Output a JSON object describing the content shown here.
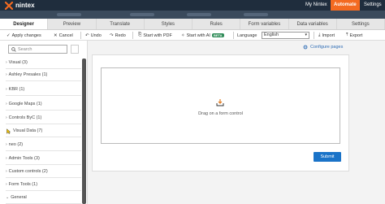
{
  "topbar": {
    "brand": "nintex",
    "links": [
      "My Nintex",
      "Automate",
      "Settings"
    ],
    "active_link": "Automate"
  },
  "tabs": [
    "Designer",
    "Preview",
    "Translate",
    "Styles",
    "Rules",
    "Form variables",
    "Data variables",
    "Settings"
  ],
  "active_tab": "Designer",
  "toolbar": {
    "apply": "Apply changes",
    "cancel": "Cancel",
    "undo": "Undo",
    "redo": "Redo",
    "start_pdf": "Start with PDF",
    "start_ai": "Start with AI",
    "ai_badge": "BETA",
    "language_label": "Language",
    "language_value": "English",
    "import": "Import",
    "export": "Export"
  },
  "left_panel": {
    "search_placeholder": "Search",
    "groups": [
      "Visual (3)",
      "Ashley Presales (1)",
      "KBR (1)",
      "Google Maps (1)",
      "Controls ByC (1)",
      "Visual Data (7)",
      "neo (2)",
      "Admin Tools (3)",
      "Custom controls (2)",
      "Form Tools (1)",
      "General"
    ]
  },
  "canvas": {
    "configure_pages": "Configure pages",
    "drop_text": "Drag on a form control",
    "submit": "Submit"
  },
  "colors": {
    "topbar": "#1f2d3d",
    "accent": "#f36a21",
    "primary": "#1a73c8",
    "beta": "#2e8b57"
  },
  "icons": [
    "nintex-logo-icon",
    "check-icon",
    "close-icon",
    "undo-icon",
    "redo-icon",
    "pdf-icon",
    "ai-icon",
    "import-icon",
    "export-icon",
    "search-icon",
    "gear-icon",
    "drag-drop-icon",
    "chevron-right-icon"
  ]
}
